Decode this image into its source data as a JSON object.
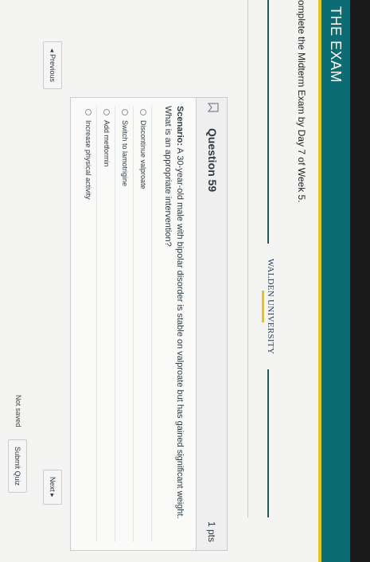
{
  "header": {
    "title": "THE EXAM"
  },
  "instruction": "omplete the Midterm Exam by Day 7 of Week 5.",
  "logo": {
    "name": "WALDEN UNIVERSITY"
  },
  "question": {
    "title": "Question 59",
    "points": "1 pts",
    "scenario_label": "Scenario:",
    "text": "A 30-year-old male with bipolar disorder is stable on valproate but has gained significant weight. What is an appropriate intervention?",
    "answers": [
      "Discontinue valproate",
      "Switch to lamotrigine",
      "Add metformin",
      "Increase physical activity"
    ]
  },
  "nav": {
    "previous": "◂ Previous",
    "next": "Next ▸"
  },
  "footer": {
    "status": "Not saved",
    "submit": "Submit Quiz"
  },
  "colors": {
    "header": "#0b6d73",
    "accent": "#f1c400",
    "text": "#2d3b45"
  }
}
